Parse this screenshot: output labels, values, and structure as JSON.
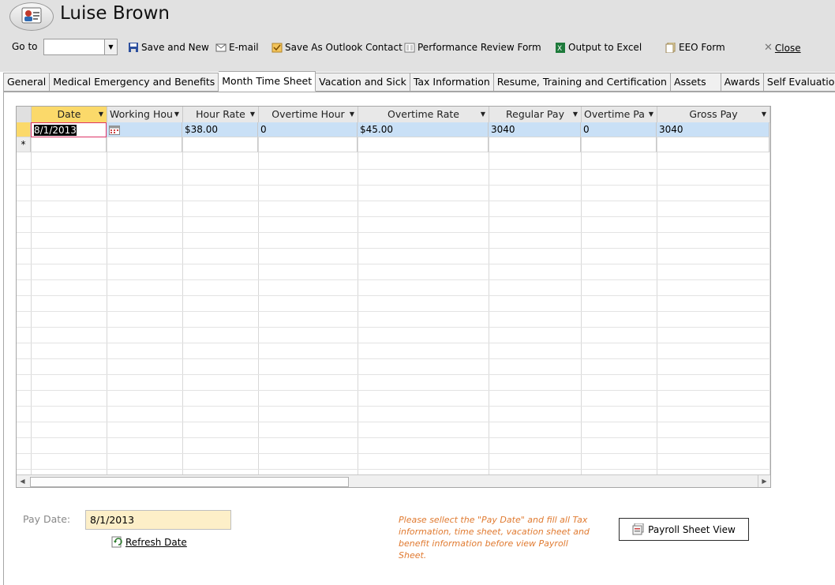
{
  "header": {
    "title": "Luise Brown",
    "goto_label": "Go to",
    "goto_value": "",
    "toolbar": {
      "save_new": "Save and New",
      "email": "E-mail",
      "save_outlook": "Save As Outlook Contact",
      "perf_review": "Performance Review Form",
      "output_excel": "Output to Excel",
      "eeo": "EEO Form",
      "close": "Close"
    }
  },
  "tabs": [
    "General",
    "Medical Emergency and Benefits",
    "Month Time Sheet",
    "Vacation and Sick",
    "Tax Information",
    "Resume, Training and Certification",
    "Assets",
    "Awards",
    "Self Evaluation"
  ],
  "active_tab": "Month Time Sheet",
  "grid": {
    "columns": [
      "Date",
      "Working Hou",
      "Hour Rate",
      "Overtime Hour",
      "Overtime Rate",
      "Regular Pay",
      "Overtime Pa",
      "Gross Pay"
    ],
    "rows": [
      [
        "8/1/2013",
        "",
        "$38.00",
        "0",
        "$45.00",
        "3040",
        "0",
        "3040"
      ]
    ],
    "new_row_marker": "*"
  },
  "footer": {
    "paydate_label": "Pay Date:",
    "paydate_value": "8/1/2013",
    "refresh_label": "Refresh Date",
    "note": "Please sellect the \"Pay Date\" and fill all Tax information, time sheet, vacation sheet and benefit information before view Payroll Sheet.",
    "payroll_button": "Payroll Sheet View"
  },
  "colors": {
    "header_bg": "#e1e1e1",
    "selected_row": "#c9e0f6",
    "active_header": "#fbd96a",
    "paydate_bg": "#fdefc8",
    "note_text": "#e07a30"
  }
}
